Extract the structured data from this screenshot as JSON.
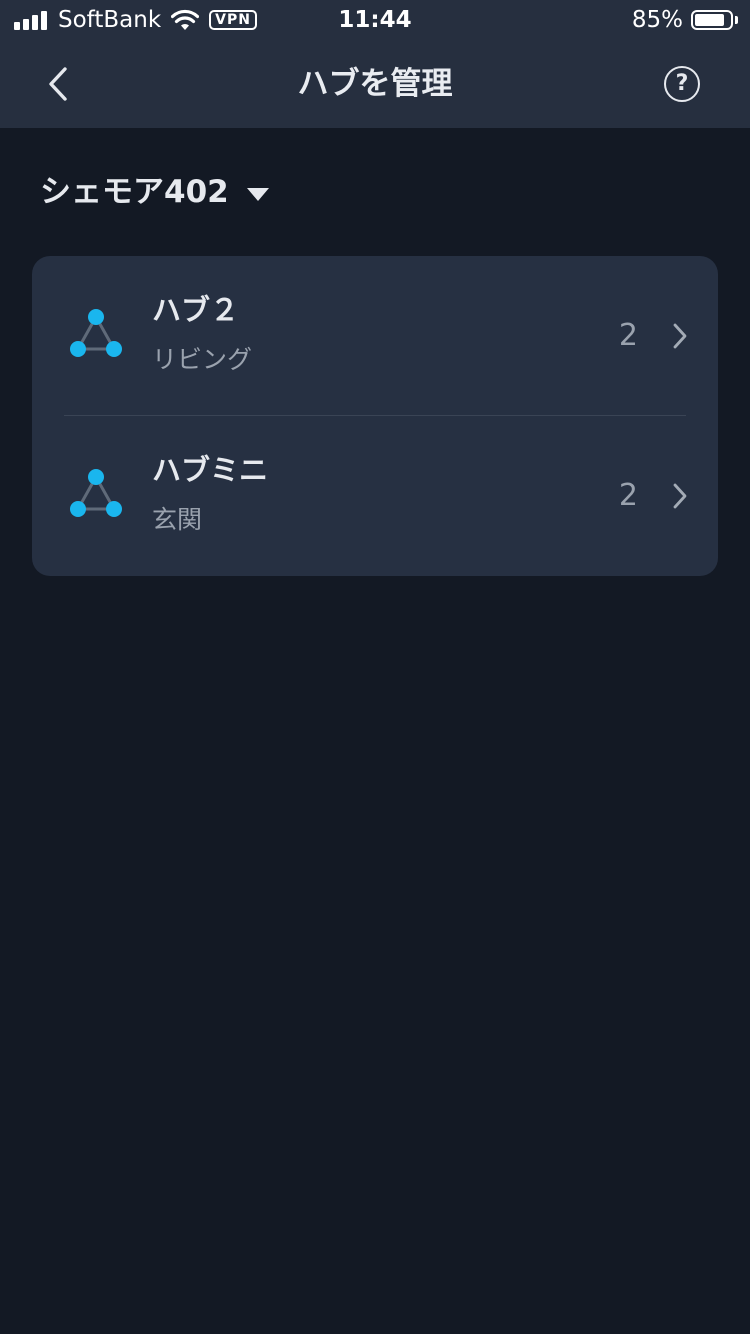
{
  "status_bar": {
    "carrier": "SoftBank",
    "vpn": "VPN",
    "time": "11:44",
    "battery_percent": "85%",
    "battery_level": 0.85
  },
  "nav": {
    "title": "ハブを管理",
    "help": "?"
  },
  "home": {
    "name": "シェモア402"
  },
  "hubs": [
    {
      "name": "ハブ２",
      "room": "リビング",
      "count": "2"
    },
    {
      "name": "ハブミニ",
      "room": "玄関",
      "count": "2"
    }
  ],
  "colors": {
    "accent": "#1ab6ee",
    "background": "#131924",
    "header": "#262f3f",
    "card": "#263042"
  },
  "icons": {
    "back": "chevron-left-icon",
    "help": "question-circle-icon",
    "dropdown": "caret-down-icon",
    "hub": "hub-triangle-icon",
    "row": "chevron-right-icon"
  }
}
